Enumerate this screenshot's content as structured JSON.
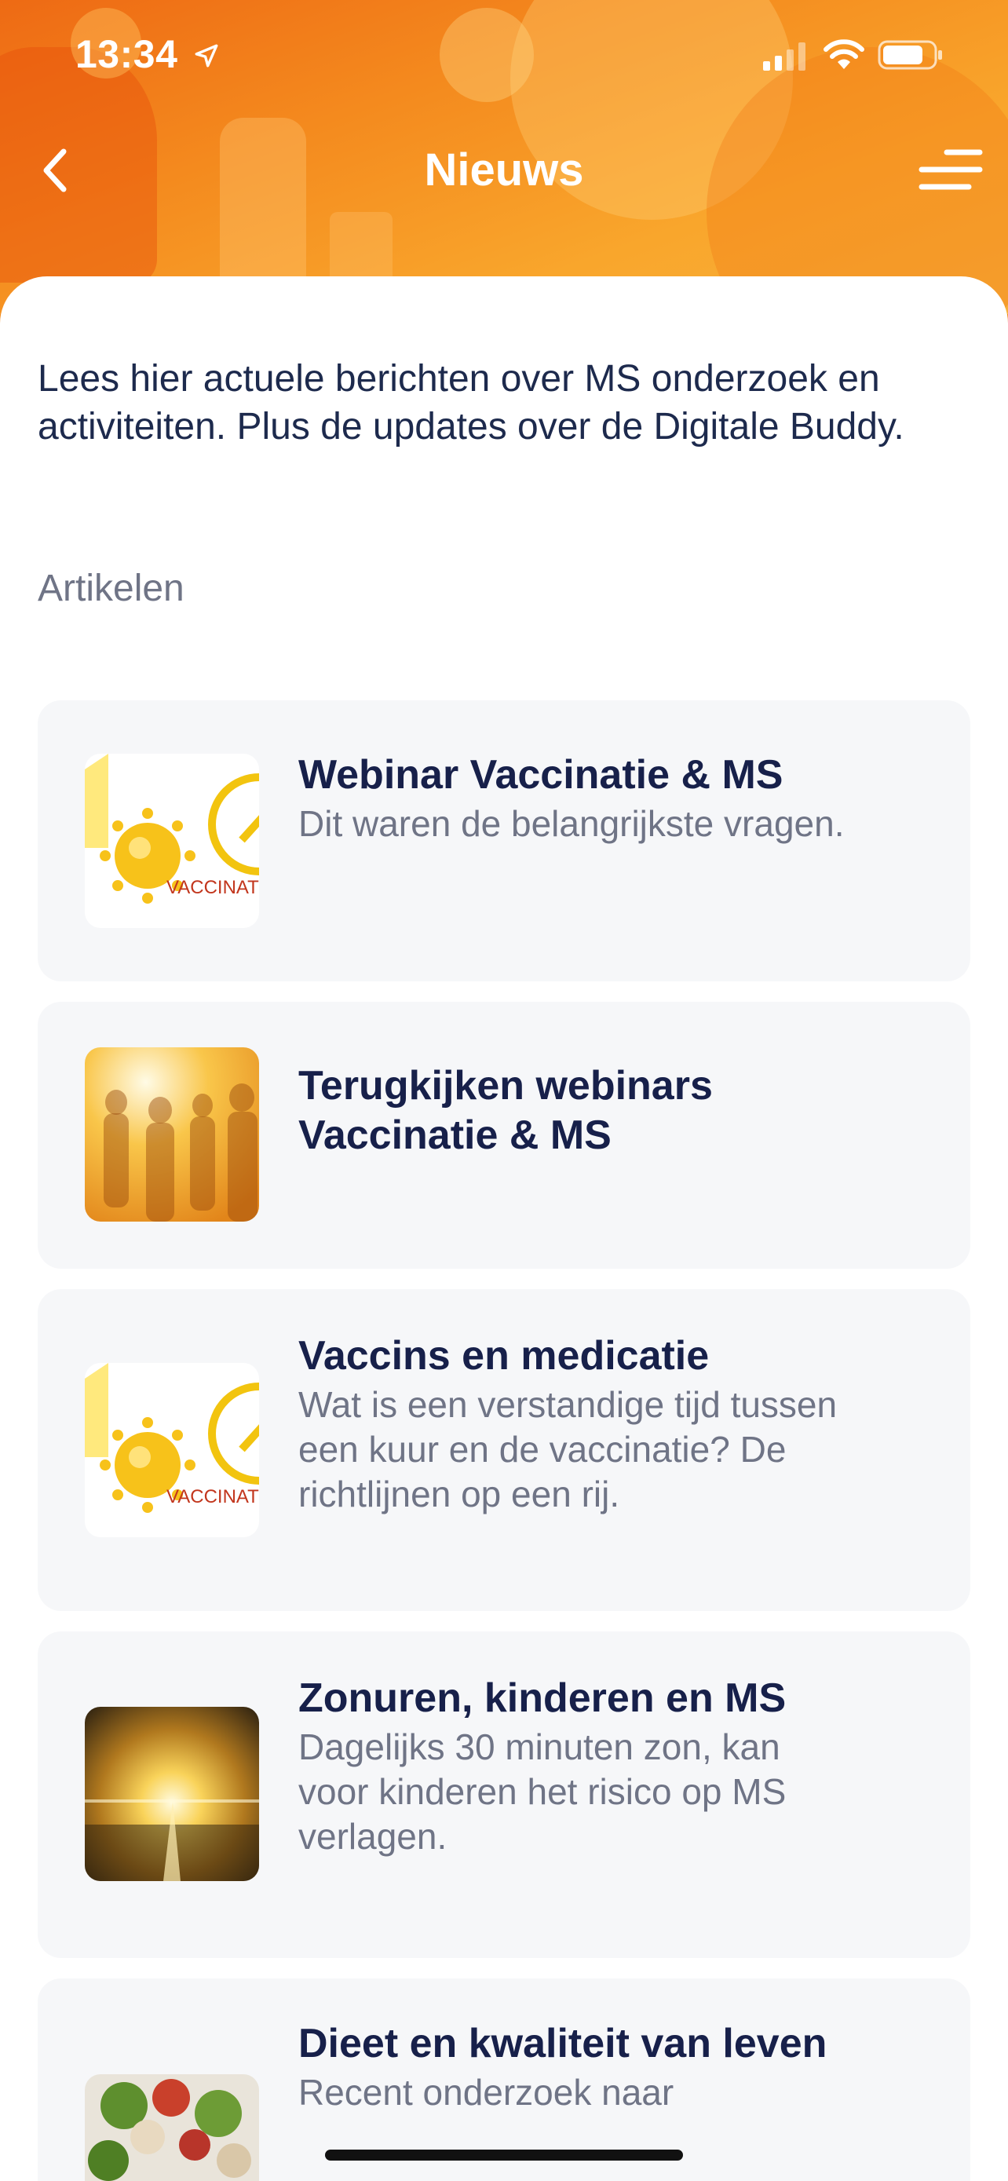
{
  "status_bar": {
    "time": "13:34",
    "icons": [
      "location-arrow-icon",
      "signal-icon",
      "wifi-icon",
      "battery-icon"
    ]
  },
  "nav": {
    "title": "Nieuws",
    "back_icon": "chevron-left-icon",
    "menu_icon": "menu-icon"
  },
  "intro": "Lees hier actuele berichten over MS onderzoek en activiteiten. Plus de updates over de Digitale Buddy.",
  "section_label": "Artikelen",
  "thumb_text": {
    "vaccinatie": "VACCINATII"
  },
  "articles": [
    {
      "title": "Webinar Vaccinatie & MS",
      "subtitle": "Dit waren de belangrijkste vragen.",
      "thumb": "vaccinatie-image"
    },
    {
      "title": "Terugkijken webinars Vaccinatie & MS",
      "subtitle": "",
      "thumb": "crowd-image"
    },
    {
      "title": "Vaccins en medicatie",
      "subtitle": "Wat is een verstandige tijd tussen een kuur en de vaccinatie? De richtlijnen op een rij.",
      "thumb": "vaccinatie-image"
    },
    {
      "title": "Zonuren, kinderen en MS",
      "subtitle": "Dagelijks 30 minuten zon, kan voor kinderen het risico op MS verlagen.",
      "thumb": "sunset-image"
    },
    {
      "title": "Dieet en kwaliteit van leven",
      "subtitle": "Recent onderzoek naar",
      "thumb": "salad-image"
    }
  ],
  "colors": {
    "header_orange": "#f48a1e",
    "title_navy": "#17204a",
    "subtitle_gray": "#6f7486",
    "card_bg": "#f6f7f9"
  }
}
